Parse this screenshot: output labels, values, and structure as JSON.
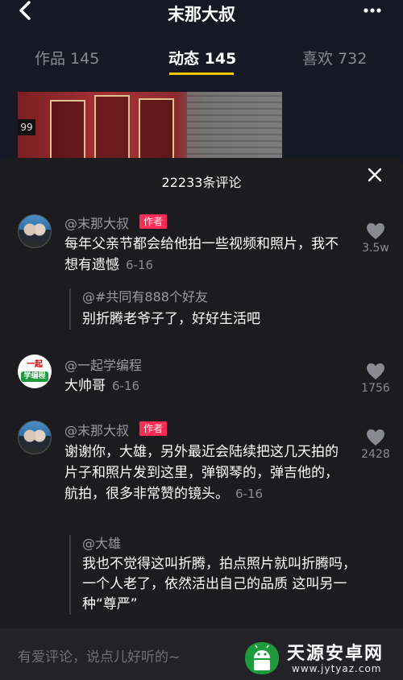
{
  "header": {
    "title": "末那大叔",
    "back_icon": "chevron-left-icon",
    "more_icon": "more-icon"
  },
  "tabs": [
    {
      "label": "作品 145",
      "active": false
    },
    {
      "label": "动态 145",
      "active": true
    },
    {
      "label": "喜欢 732",
      "active": false
    }
  ],
  "colors": {
    "accent": "#ffc300",
    "author_badge": "#fe2c55",
    "sheet_bg": "#1c1c1e",
    "page_bg": "#161823"
  },
  "thumbnail": {
    "number": "99"
  },
  "comments_sheet": {
    "title": "22233条评论",
    "close_icon": "close-icon",
    "comments": [
      {
        "username": "@末那大叔",
        "badge": "作者",
        "text": "每年父亲节都会给他拍一些视频和照片，我不想有遗憾",
        "date": "6-16",
        "likes": "3.5w",
        "reply": {
          "username": "@#共同有888个好友",
          "text": "别折腾老爷子了，好好生活吧"
        }
      },
      {
        "username": "@一起学编程",
        "avatar_text_top": "一起",
        "avatar_text_bottom": "学编程",
        "text": "大帅哥",
        "date": "6-16",
        "likes": "1756"
      },
      {
        "username": "@末那大叔",
        "badge": "作者",
        "text": "谢谢你，大雄，另外最近会陆续把这几天拍的片子和照片发到这里，弹钢琴的，弹吉他的，航拍，很多非常赞的镜头。",
        "date": "6-16",
        "likes": "2428",
        "reply": {
          "username": "@大雄",
          "text": "我也不觉得这叫折腾，拍点照片就叫折腾吗，一个人老了，依然活出自己的品质 这叫另一种“尊严”"
        }
      }
    ]
  },
  "input": {
    "placeholder": "有爱评论，说点儿好听的~"
  },
  "watermark": {
    "name": "天源安卓网",
    "url": "www.jytyaz.com"
  }
}
